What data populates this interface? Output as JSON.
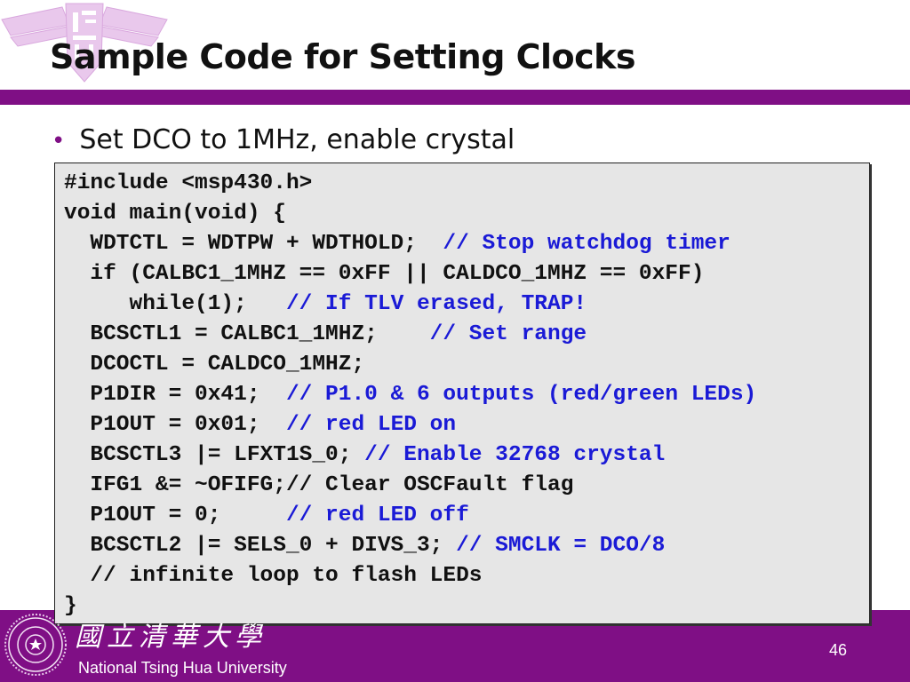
{
  "slide": {
    "title": "Sample Code for Setting Clocks",
    "bullet": "Set DCO to 1MHz, enable crystal",
    "page_number": "46"
  },
  "code_lines": [
    {
      "code": "#include <msp430.h>",
      "comment": ""
    },
    {
      "code": "void main(void) {",
      "comment": ""
    },
    {
      "code": "  WDTCTL = WDTPW + WDTHOLD;  ",
      "comment": "// Stop watchdog timer"
    },
    {
      "code": "  if (CALBC1_1MHZ == 0xFF || CALDCO_1MHZ == 0xFF)",
      "comment": ""
    },
    {
      "code": "     while(1);   ",
      "comment": "// If TLV erased, TRAP!"
    },
    {
      "code": "  BCSCTL1 = CALBC1_1MHZ;    ",
      "comment": "// Set range"
    },
    {
      "code": "  DCOCTL = CALDCO_1MHZ;",
      "comment": ""
    },
    {
      "code": "  P1DIR = 0x41;  ",
      "comment": "// P1.0 & 6 outputs (red/green LEDs)"
    },
    {
      "code": "  P1OUT = 0x01;  ",
      "comment": "// red LED on"
    },
    {
      "code": "  BCSCTL3 |= LFXT1S_0; ",
      "comment": "// Enable 32768 crystal"
    },
    {
      "code": "  IFG1 &= ~OFIFG;// Clear OSCFault flag",
      "comment": ""
    },
    {
      "code": "  P1OUT = 0;     ",
      "comment": "// red LED off"
    },
    {
      "code": "  BCSCTL2 |= SELS_0 + DIVS_3; ",
      "comment": "// SMCLK = DCO/8"
    },
    {
      "code": "  // infinite loop to flash LEDs",
      "comment": ""
    },
    {
      "code": "}",
      "comment": ""
    }
  ],
  "footer": {
    "university_name_chinese": "國立清華大學",
    "university_name": "National Tsing Hua University"
  },
  "colors": {
    "brand_purple": "#7f0f85",
    "comment_blue": "#1a1ad6",
    "code_background": "#e6e6e6"
  }
}
